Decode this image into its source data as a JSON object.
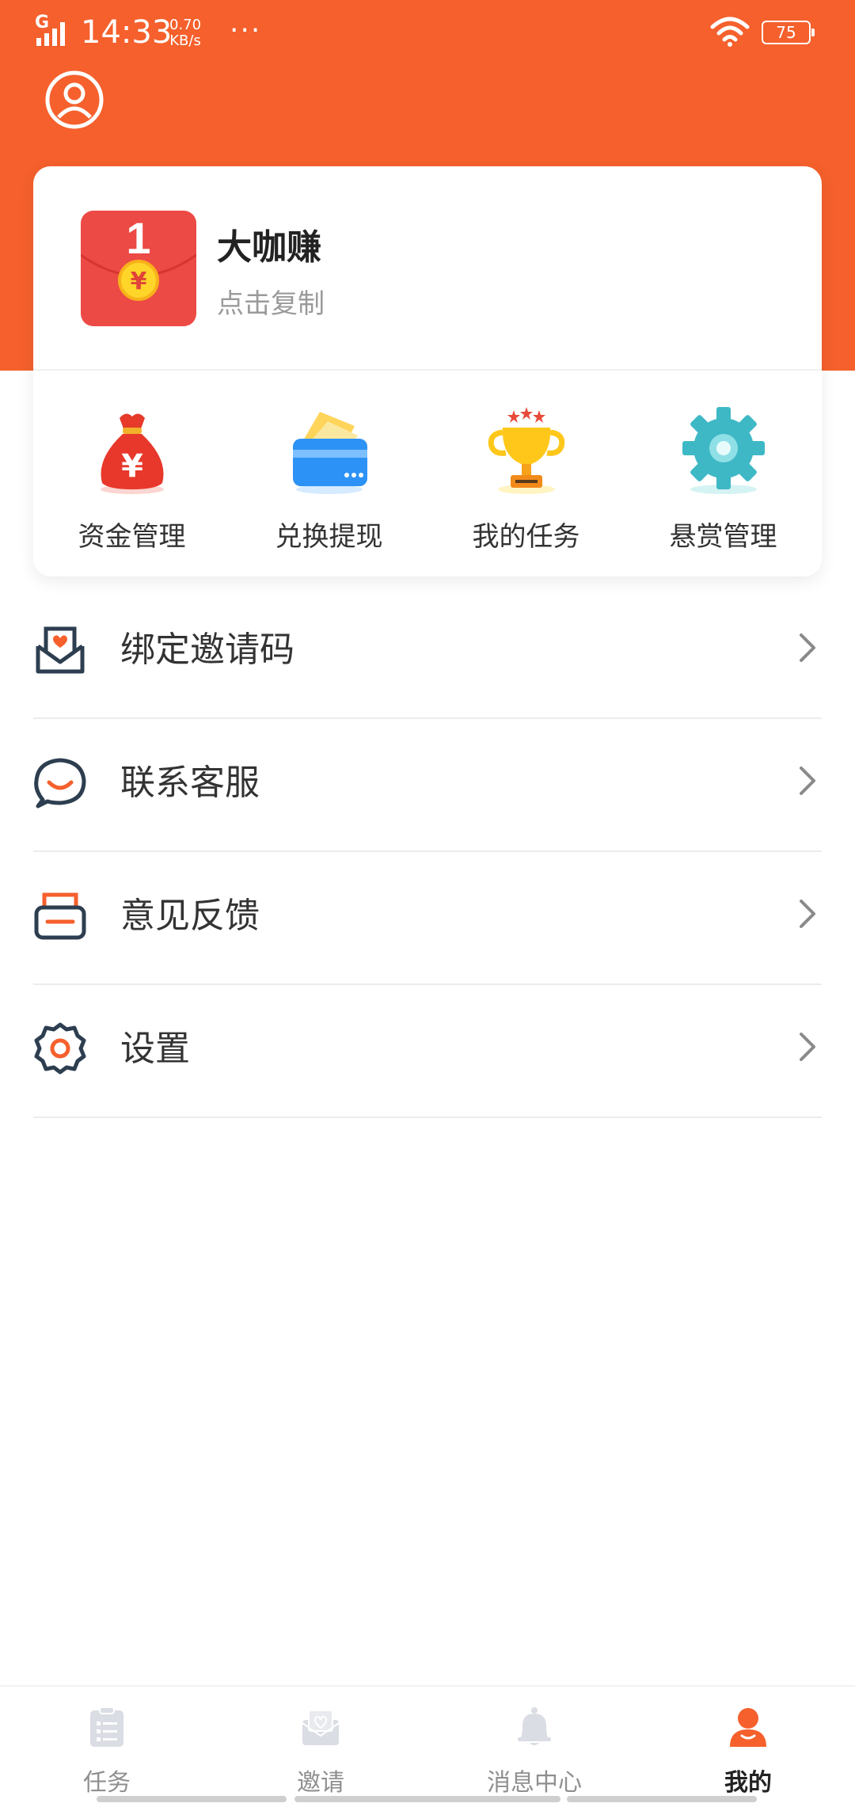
{
  "status_bar": {
    "network": "G",
    "time": "14:33",
    "speed_value": "0.70",
    "speed_unit": "KB/s",
    "dots": "···",
    "battery": "75"
  },
  "profile": {
    "app_name": "大咖赚",
    "copy_label": "点击复制"
  },
  "quick_actions": [
    {
      "label": "资金管理",
      "icon": "money-bag-icon"
    },
    {
      "label": "兑换提现",
      "icon": "card-wallet-icon"
    },
    {
      "label": "我的任务",
      "icon": "trophy-icon"
    },
    {
      "label": "悬赏管理",
      "icon": "gear-icon"
    }
  ],
  "menu": [
    {
      "label": "绑定邀请码",
      "icon": "envelope-heart-icon"
    },
    {
      "label": "联系客服",
      "icon": "chat-smile-icon"
    },
    {
      "label": "意见反馈",
      "icon": "feedback-box-icon"
    },
    {
      "label": "设置",
      "icon": "settings-icon"
    }
  ],
  "tabs": [
    {
      "label": "任务",
      "icon": "clipboard-icon",
      "active": false
    },
    {
      "label": "邀请",
      "icon": "invite-icon",
      "active": false
    },
    {
      "label": "消息中心",
      "icon": "bell-icon",
      "active": false
    },
    {
      "label": "我的",
      "icon": "profile-icon",
      "active": true
    }
  ],
  "colors": {
    "accent": "#f5602c",
    "text_dark": "#333333",
    "text_muted": "#9a9a9a"
  }
}
